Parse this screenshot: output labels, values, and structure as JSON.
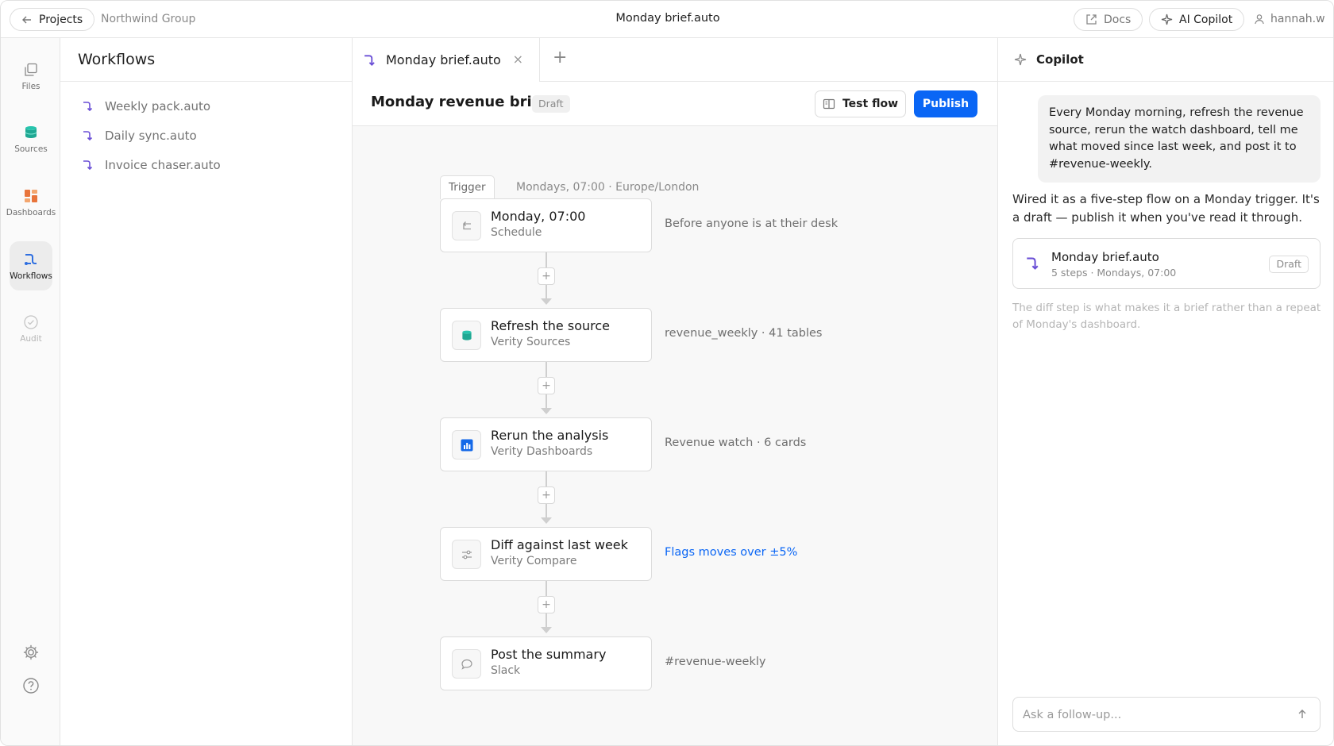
{
  "topbar": {
    "back_label": "Projects",
    "breadcrumb": "Northwind Group",
    "document_title": "Monday brief.auto",
    "docs_label": "Docs",
    "copilot_label": "AI Copilot",
    "username": "hannah.w"
  },
  "rail": {
    "items": [
      {
        "label": "Files",
        "icon": "files-icon"
      },
      {
        "label": "Sources",
        "icon": "database-icon"
      },
      {
        "label": "Dashboards",
        "icon": "dashboard-icon"
      },
      {
        "label": "Workflows",
        "icon": "workflow-icon",
        "active": true
      },
      {
        "label": "Audit",
        "icon": "check-circle-icon",
        "disabled": true
      }
    ],
    "bottom": [
      "settings-icon",
      "help-icon"
    ]
  },
  "workflows_panel": {
    "title": "Workflows",
    "items": [
      "Weekly pack.auto",
      "Daily sync.auto",
      "Invoice chaser.auto"
    ]
  },
  "editor": {
    "tab_label": "Monday brief.auto",
    "title": "Monday revenue brief",
    "status": "Draft",
    "test_label": "Test flow",
    "publish_label": "Publish",
    "trigger_tag": "Trigger",
    "trigger_info": "Mondays, 07:00 · Europe/London",
    "steps": [
      {
        "title": "Monday, 07:00",
        "subtitle": "Schedule",
        "note": "Before anyone is at their desk",
        "icon": "schedule-icon"
      },
      {
        "title": "Refresh the source",
        "subtitle": "Verity Sources",
        "note": "revenue_weekly · 41 tables",
        "icon": "database-icon"
      },
      {
        "title": "Rerun the analysis",
        "subtitle": "Verity Dashboards",
        "note": "Revenue watch · 6 cards",
        "icon": "chart-icon"
      },
      {
        "title": "Diff against last week",
        "subtitle": "Verity Compare",
        "note": "Flags moves over ±5%",
        "icon": "sliders-icon",
        "note_is_link": true
      },
      {
        "title": "Post the summary",
        "subtitle": "Slack",
        "note": "#revenue-weekly",
        "icon": "chat-bubble-icon"
      }
    ],
    "add_step_symbol": "+"
  },
  "copilot": {
    "title": "Copilot",
    "user_message": "Every Monday morning, refresh the revenue source, rerun the watch dashboard, tell me what moved since last week, and post it to #revenue-weekly.",
    "assistant_message": "Wired it as a five-step flow on a Monday trigger. It's a draft — publish it when you've read it through.",
    "card": {
      "title": "Monday brief.auto",
      "subtitle": "5 steps · Mondays, 07:00",
      "badge": "Draft"
    },
    "assistant_note": "The diff step is what makes it a brief rather than a repeat of Monday's dashboard.",
    "input_placeholder": "Ask a follow-up...",
    "input_value": ""
  },
  "colors": {
    "accent": "#0a66f5",
    "workflow_purple": "#6a4fd6",
    "sources_teal": "#1fb5a0",
    "dashboards_orange": "#e8743b"
  }
}
